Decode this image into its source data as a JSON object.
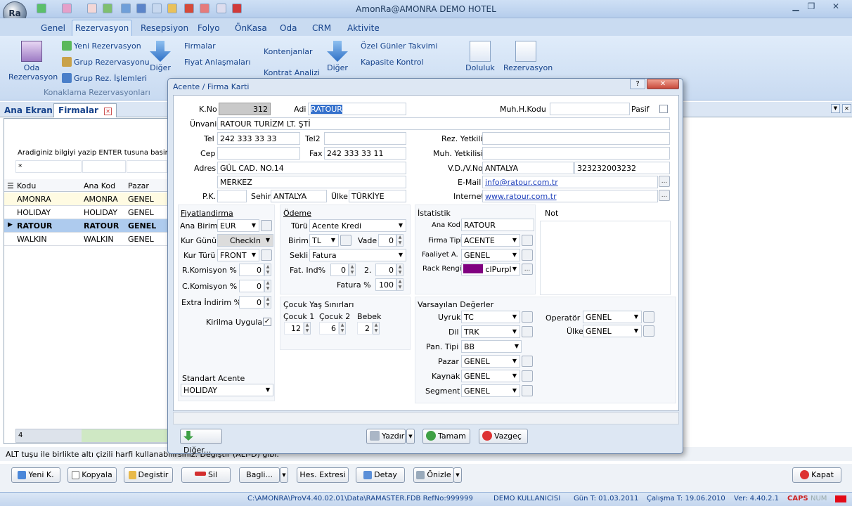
{
  "window": {
    "title": "AmonRa@AMONRA DEMO HOTEL"
  },
  "menu": [
    "Genel",
    "Rezervasyon",
    "Resepsiyon",
    "Folyo",
    "ÖnKasa",
    "Oda",
    "CRM",
    "Aktivite"
  ],
  "ribbon": {
    "oda_rez": "Oda\nRezervasyon",
    "oda_rez_l1": "Oda",
    "oda_rez_l2": "Rezervasyon",
    "yeni_rez": "Yeni Rezervasyon",
    "grup_rez": "Grup Rezervasyonu",
    "grup_islem": "Grup Rez. İşlemleri",
    "diger": "Diğer",
    "firmalar": "Firmalar",
    "fiyat": "Fiyat Anlaşmaları",
    "kontenjan": "Kontenjanlar",
    "kontrat": "Kontrat Analizi",
    "diger2": "Diğer",
    "ozel": "Özel Günler Takvimi",
    "kapasite": "Kapasite Kontrol",
    "doluluk": "Doluluk",
    "rezervasyon": "Rezervasyon",
    "group_label": "Konaklama Rezervasyonları"
  },
  "doctabs": {
    "ana": "Ana Ekran",
    "firmalar": "Firmalar"
  },
  "search": {
    "hint": "Aradiginiz bilgiyi yazip ENTER tusuna basiniz.",
    "value": "*"
  },
  "grid": {
    "headers": [
      "Kodu",
      "Ana Kod",
      "Pazar"
    ],
    "rows": [
      [
        "AMONRA",
        "AMONRA",
        "GENEL"
      ],
      [
        "HOLIDAY",
        "HOLIDAY",
        "GENEL"
      ],
      [
        "RATOUR",
        "RATOUR",
        "GENEL"
      ],
      [
        "WALKIN",
        "WALKIN",
        "GENEL"
      ]
    ],
    "count": "4"
  },
  "dialog": {
    "title": "Acente / Firma Karti",
    "kno_label": "K.No",
    "kno": "312",
    "adi_label": "Adi",
    "adi": "RATOUR",
    "muh_kodu_label": "Muh.H.Kodu",
    "pasif_label": "Pasif",
    "unvani_label": "Ünvani",
    "unvani": "RATOUR TURİZM LT. ŞTİ",
    "tel_label": "Tel",
    "tel": "242 333 33 33",
    "tel2_label": "Tel2",
    "rez_yetkili_label": "Rez. Yetkili",
    "cep_label": "Cep",
    "fax_label": "Fax",
    "fax": "242 333 33 11",
    "muh_yetkili_label": "Muh. Yetkilisi",
    "adres_label": "Adres",
    "adres1": "GÜL CAD. NO.14",
    "adres2": "MERKEZ",
    "vd_label": "V.D./V.No",
    "vd": "ANTALYA",
    "vno": "323232003232",
    "email_label": "E-Mail",
    "email": "info@ratour.com.tr",
    "pk_label": "P.K.",
    "sehir_label": "Sehir",
    "sehir": "ANTALYA",
    "ulke_label": "Ülke",
    "ulke": "TÜRKİYE",
    "internet_label": "Internet",
    "internet": "www.ratour.com.tr",
    "fiyat": {
      "title": "Fiyatlandirma",
      "ana_birim_label": "Ana Birim",
      "ana_birim": "EUR",
      "kur_gunu_label": "Kur Günü",
      "kur_gunu": "CheckIn",
      "kur_turu_label": "Kur Türü",
      "kur_turu": "FRONT",
      "rkom_label": "R.Komisyon %",
      "rkom": "0",
      "ckom_label": "C.Komisyon %",
      "ckom": "0",
      "extra_label": "Extra İndirim %",
      "extra": "0",
      "kirilma_label": "Kirilma Uygula",
      "kirilma": "✓",
      "standart_label": "Standart Acente",
      "standart": "HOLIDAY"
    },
    "odeme": {
      "title": "Ödeme",
      "turu_label": "Türü",
      "turu": "Acente Kredi",
      "birim_label": "Birim",
      "birim": "TL",
      "vade_label": "Vade",
      "vade": "0",
      "sekli_label": "Sekli",
      "sekli": "Fatura",
      "fatind_label": "Fat. Ind%",
      "fatind": "0",
      "two_label": "2.",
      "two": "0",
      "fatura_label": "Fatura %",
      "fatura": "100"
    },
    "cocuk": {
      "title": "Çocuk Yaş Sınırları",
      "c1_label": "Çocuk 1",
      "c1": "12",
      "c2_label": "Çocuk 2",
      "c2": "6",
      "bebek_label": "Bebek",
      "bebek": "2"
    },
    "istatistik": {
      "title": "İstatistik",
      "anakod_label": "Ana Kod",
      "anakod": "RATOUR",
      "firmatipi_label": "Firma Tipi",
      "firmatipi": "ACENTE",
      "faaliyet_label": "Faaliyet A.",
      "faaliyet": "GENEL",
      "rack_label": "Rack Rengi",
      "rack": "clPurpl",
      "rack_color": "#800080"
    },
    "not_label": "Not",
    "vars": {
      "title": "Varsayılan Değerler",
      "uyruk_label": "Uyruk",
      "uyruk": "TC",
      "dil_label": "Dil",
      "dil": "TRK",
      "pan_label": "Pan. Tipi",
      "pan": "BB",
      "pazar_label": "Pazar",
      "pazar": "GENEL",
      "kaynak_label": "Kaynak",
      "kaynak": "GENEL",
      "segment_label": "Segment",
      "segment": "GENEL",
      "operator_label": "Operatör",
      "operator": "GENEL",
      "ulke_label": "Ülke",
      "ulke": "GENEL"
    },
    "buttons": {
      "diger": "Diğer...",
      "yazdir": "Yazdır",
      "tamam": "Tamam",
      "vazgec": "Vazgeç"
    }
  },
  "status_line": "ALT tuşu ile birlikte altı çizili harfi kullanabilirsiniz. Değiştir (ALT-D) gibi.",
  "bottom_buttons": {
    "yeni": "Yeni K.",
    "kopyala": "Kopyala",
    "degistir": "Degistir",
    "sil": "Sil",
    "bagli": "Bagli...",
    "hes": "Hes. Extresi",
    "detay": "Detay",
    "onizle": "Önizle",
    "kapat": "Kapat"
  },
  "statusbar": {
    "path": "C:\\AMONRA\\ProV4.40.02.01\\Data\\RAMASTER.FDB RefNo:999999",
    "user": "DEMO KULLANICISI",
    "gun": "Gün T: 01.03.2011",
    "calisma": "Çalışma T: 19.06.2010",
    "ver": "Ver: 4.40.2.1",
    "caps": "CAPS",
    "num": "NUM"
  }
}
